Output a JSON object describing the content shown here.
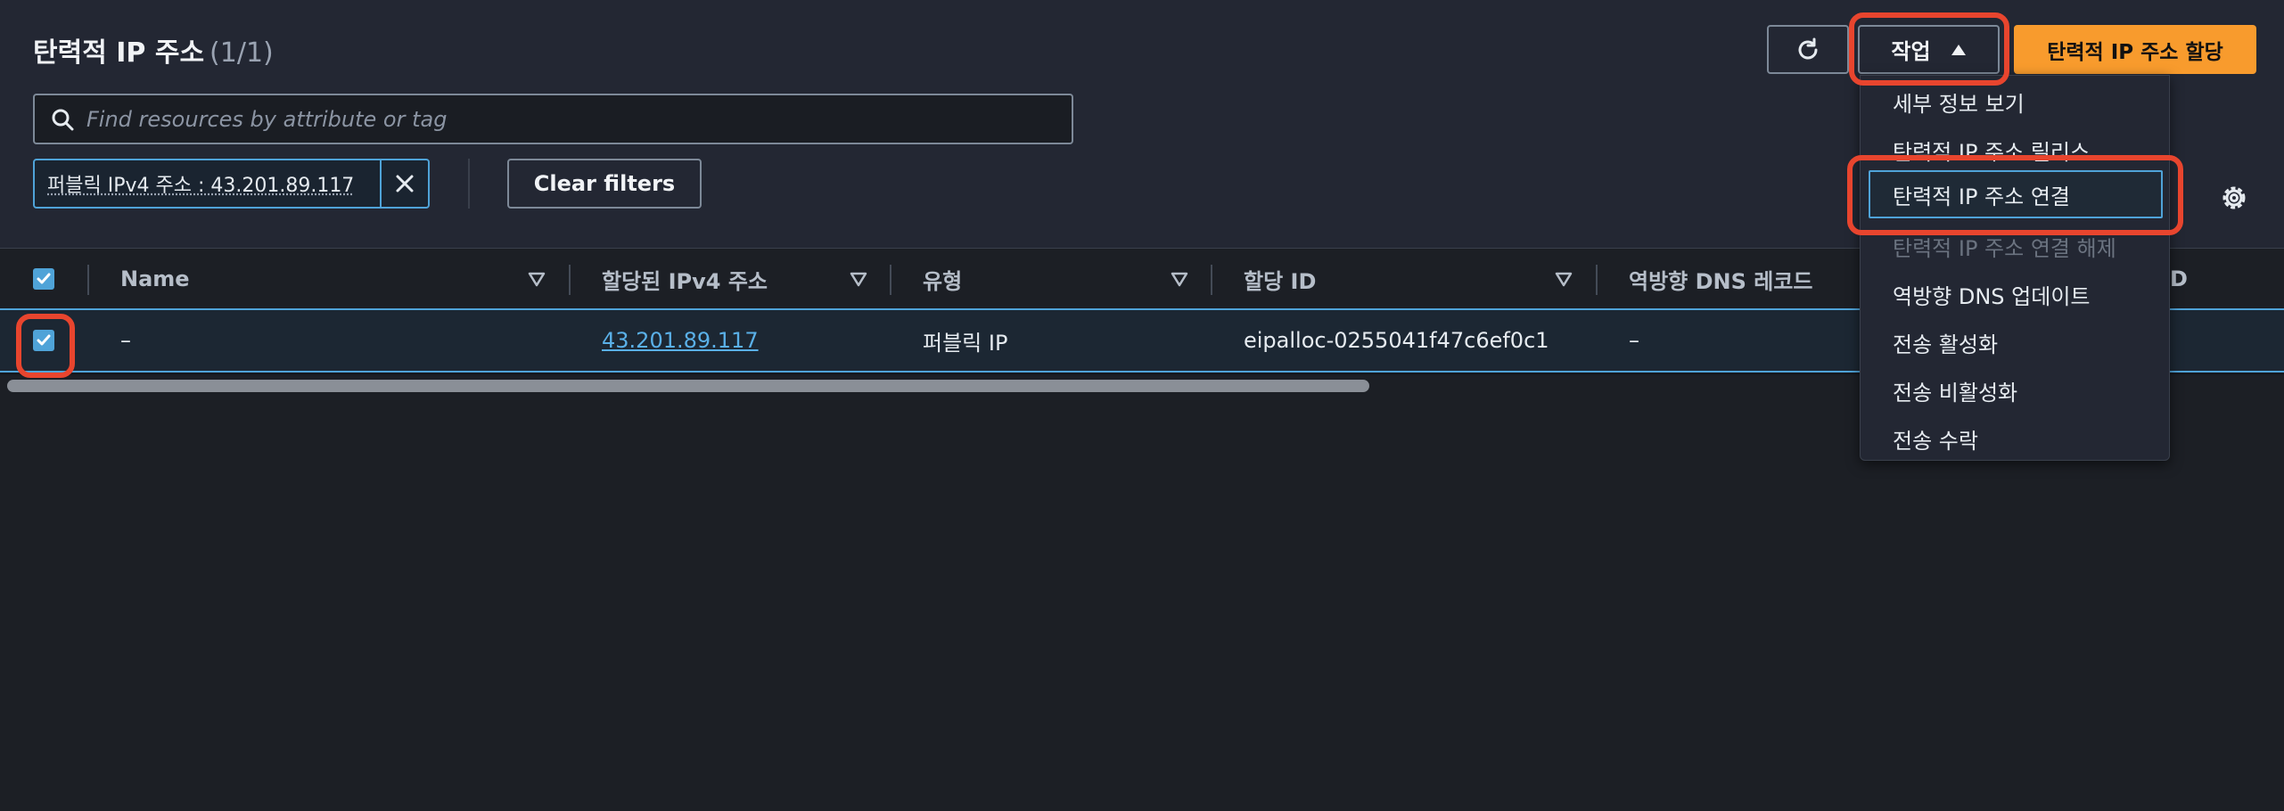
{
  "header": {
    "title": "탄력적 IP 주소",
    "count": "(1/1)",
    "actions_label": "작업",
    "primary_label": "탄력적 IP 주소 할당"
  },
  "search": {
    "placeholder": "Find resources by attribute or tag"
  },
  "filter": {
    "token": "퍼블릭 IPv4 주소 : 43.201.89.117",
    "clear_label": "Clear filters"
  },
  "table": {
    "columns": [
      "Name",
      "할당된 IPv4 주소",
      "유형",
      "할당 ID",
      "역방향 DNS 레코드",
      "D"
    ],
    "row": {
      "name": "–",
      "ipv4": "43.201.89.117",
      "type": "퍼블릭 IP",
      "allocation_id": "eipalloc-0255041f47c6ef0c1",
      "reverse_dns": "–"
    }
  },
  "menu": {
    "items": [
      "세부 정보 보기",
      "탄력적 IP 주소 릴리스",
      "탄력적 IP 주소 연결",
      "탄력적 IP 주소 연결 해제",
      "역방향 DNS 업데이트",
      "전송 활성화",
      "전송 비활성화",
      "전송 수락"
    ]
  },
  "colors": {
    "accent": "#4fa3d8",
    "primary": "#f89b2d",
    "annotation": "#e8452e"
  },
  "icons": [
    "refresh-icon",
    "caret-up-icon",
    "search-icon",
    "close-icon",
    "settings-icon",
    "sort-icon",
    "checkbox-icon"
  ]
}
